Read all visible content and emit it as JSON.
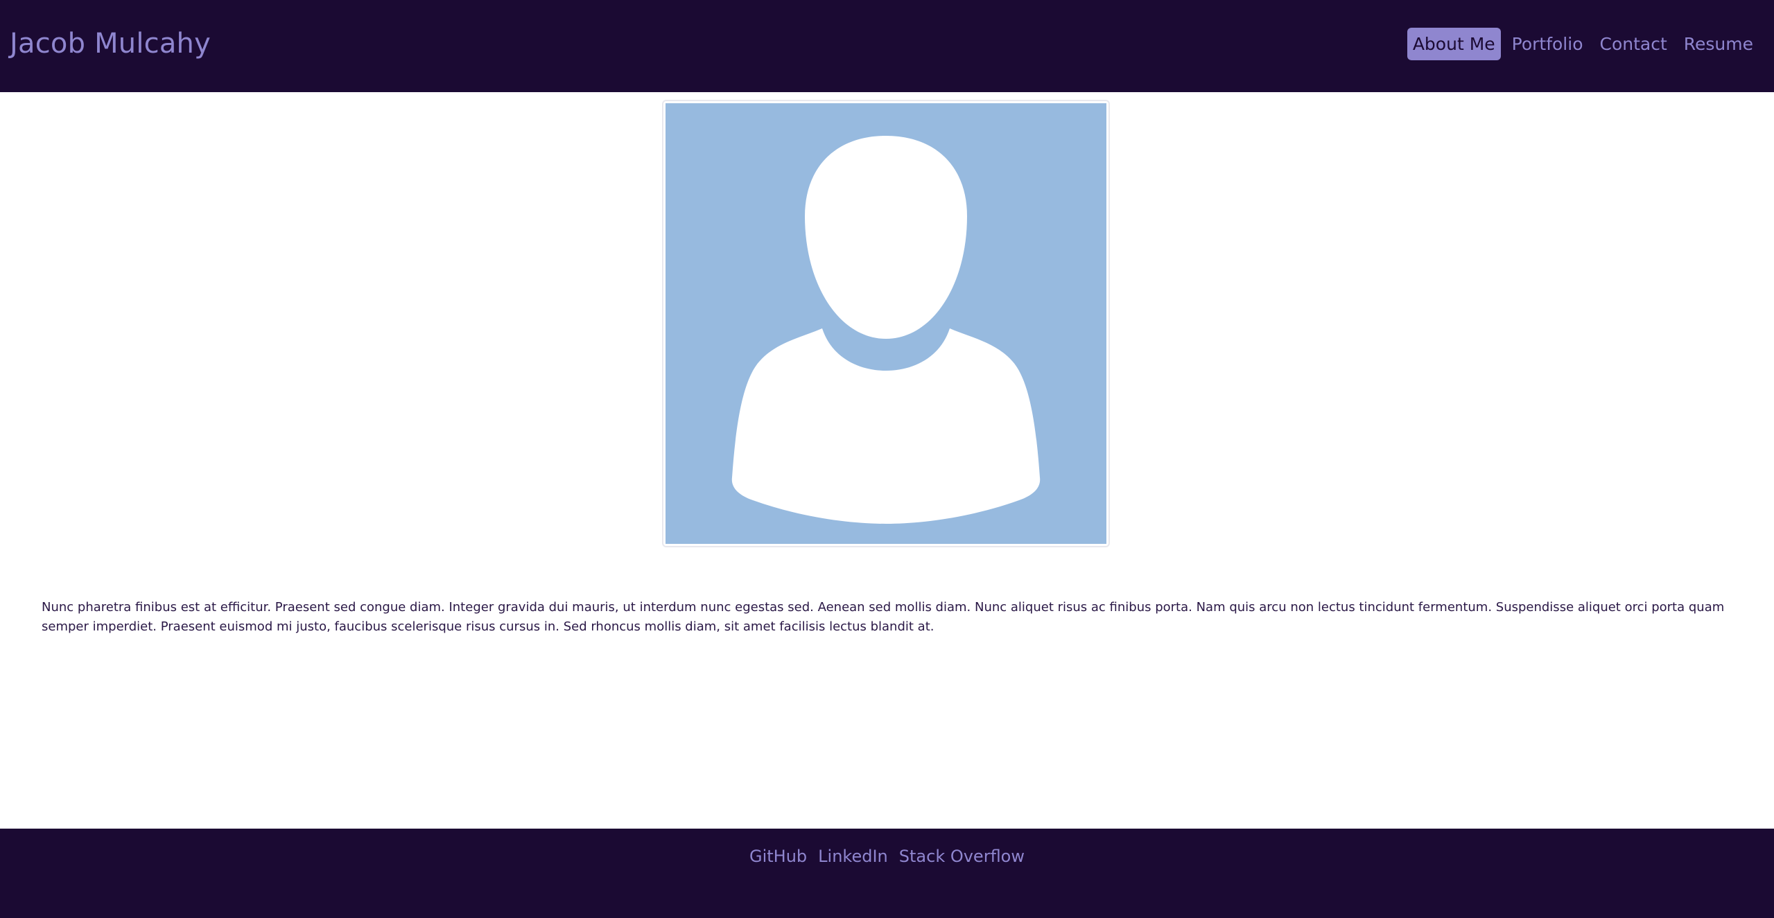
{
  "header": {
    "brand": "Jacob Mulcahy",
    "nav": [
      {
        "label": "About Me",
        "active": true
      },
      {
        "label": "Portfolio",
        "active": false
      },
      {
        "label": "Contact",
        "active": false
      },
      {
        "label": "Resume",
        "active": false
      }
    ]
  },
  "main": {
    "avatar_icon": "person-silhouette-icon",
    "bio": "Nunc pharetra finibus est at efficitur. Praesent sed congue diam. Integer gravida dui mauris, ut interdum nunc egestas sed. Aenean sed mollis diam. Nunc aliquet risus ac finibus porta. Nam quis arcu non lectus tincidunt fermentum. Suspendisse aliquet orci porta quam semper imperdiet. Praesent euismod mi justo, faucibus scelerisque risus cursus in. Sed rhoncus mollis diam, sit amet facilisis lectus blandit at."
  },
  "footer": {
    "links": [
      "GitHub",
      "LinkedIn",
      "Stack Overflow"
    ]
  },
  "colors": {
    "header_bg": "#1b0a33",
    "accent": "#8f86cf",
    "avatar_bg": "#97badf",
    "text": "#2a1846"
  }
}
